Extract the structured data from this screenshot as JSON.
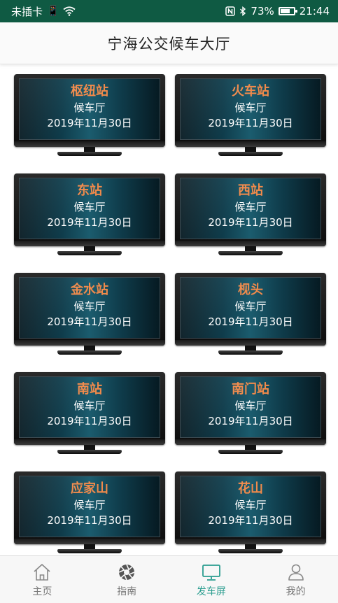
{
  "status_bar": {
    "carrier": "未插卡",
    "battery": "73%",
    "battery_level": 0.73,
    "time": "21:44"
  },
  "header": {
    "title": "宁海公交候车大厅"
  },
  "stations": [
    {
      "name": "枢纽站",
      "hall": "候车厅",
      "date": "2019年11月30日"
    },
    {
      "name": "火车站",
      "hall": "候车厅",
      "date": "2019年11月30日"
    },
    {
      "name": "东站",
      "hall": "候车厅",
      "date": "2019年11月30日"
    },
    {
      "name": "西站",
      "hall": "候车厅",
      "date": "2019年11月30日"
    },
    {
      "name": "金水站",
      "hall": "候车厅",
      "date": "2019年11月30日"
    },
    {
      "name": "枧头",
      "hall": "候车厅",
      "date": "2019年11月30日"
    },
    {
      "name": "南站",
      "hall": "候车厅",
      "date": "2019年11月30日"
    },
    {
      "name": "南门站",
      "hall": "候车厅",
      "date": "2019年11月30日"
    },
    {
      "name": "应家山",
      "hall": "候车厅",
      "date": "2019年11月30日"
    },
    {
      "name": "花山",
      "hall": "候车厅",
      "date": "2019年11月30日"
    }
  ],
  "tabs": [
    {
      "label": "主页",
      "icon": "home-icon",
      "active": false
    },
    {
      "label": "指南",
      "icon": "aperture-icon",
      "active": false
    },
    {
      "label": "发车屏",
      "icon": "monitor-icon",
      "active": true
    },
    {
      "label": "我的",
      "icon": "person-icon",
      "active": false
    }
  ],
  "colors": {
    "status_bar": "#0f5a43",
    "station_name": "#f08a4b",
    "active_tab": "#2a9d8f",
    "inactive_tab": "#777777"
  }
}
